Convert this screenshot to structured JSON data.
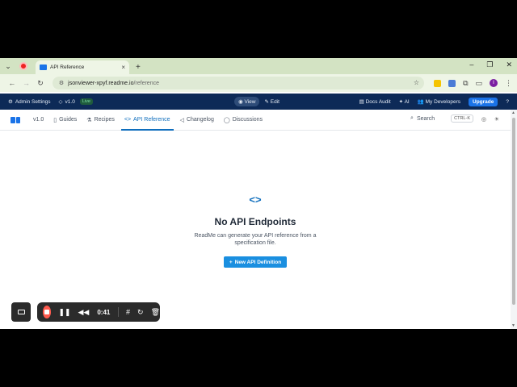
{
  "browser": {
    "tab_title": "API Reference",
    "tab_close": "×",
    "new_tab": "+",
    "url_host": "jsonviewer-xpyf.readme.io",
    "url_path": "/reference",
    "profile_initial": "I",
    "minimize": "–",
    "restore": "❐",
    "close": "✕"
  },
  "adminbar": {
    "admin_settings": "Admin Settings",
    "version": "v1.0",
    "live_badge": "Live",
    "view": "View",
    "edit": "Edit",
    "docs_audit": "Docs Audit",
    "ai": "AI",
    "my_developers": "My Developers",
    "upgrade": "Upgrade",
    "help": "?"
  },
  "projnav": {
    "version": "v1.0",
    "items": [
      {
        "label": "Guides",
        "icon": "book-icon"
      },
      {
        "label": "Recipes",
        "icon": "flask-icon"
      },
      {
        "label": "API Reference",
        "icon": "code-icon",
        "active": true
      },
      {
        "label": "Changelog",
        "icon": "megaphone-icon"
      },
      {
        "label": "Discussions",
        "icon": "chat-icon"
      }
    ],
    "search_label": "Search",
    "search_shortcut": "CTRL-K"
  },
  "empty_state": {
    "title": "No API Endpoints",
    "description": "ReadMe can generate your API reference from a specification file.",
    "button_label": "New API Definition"
  },
  "recorder": {
    "time": "0:41"
  },
  "colors": {
    "admin_bar": "#0d2a57",
    "accent": "#0f6ebd",
    "button": "#1a8fe0",
    "record": "#ff5a4e"
  }
}
